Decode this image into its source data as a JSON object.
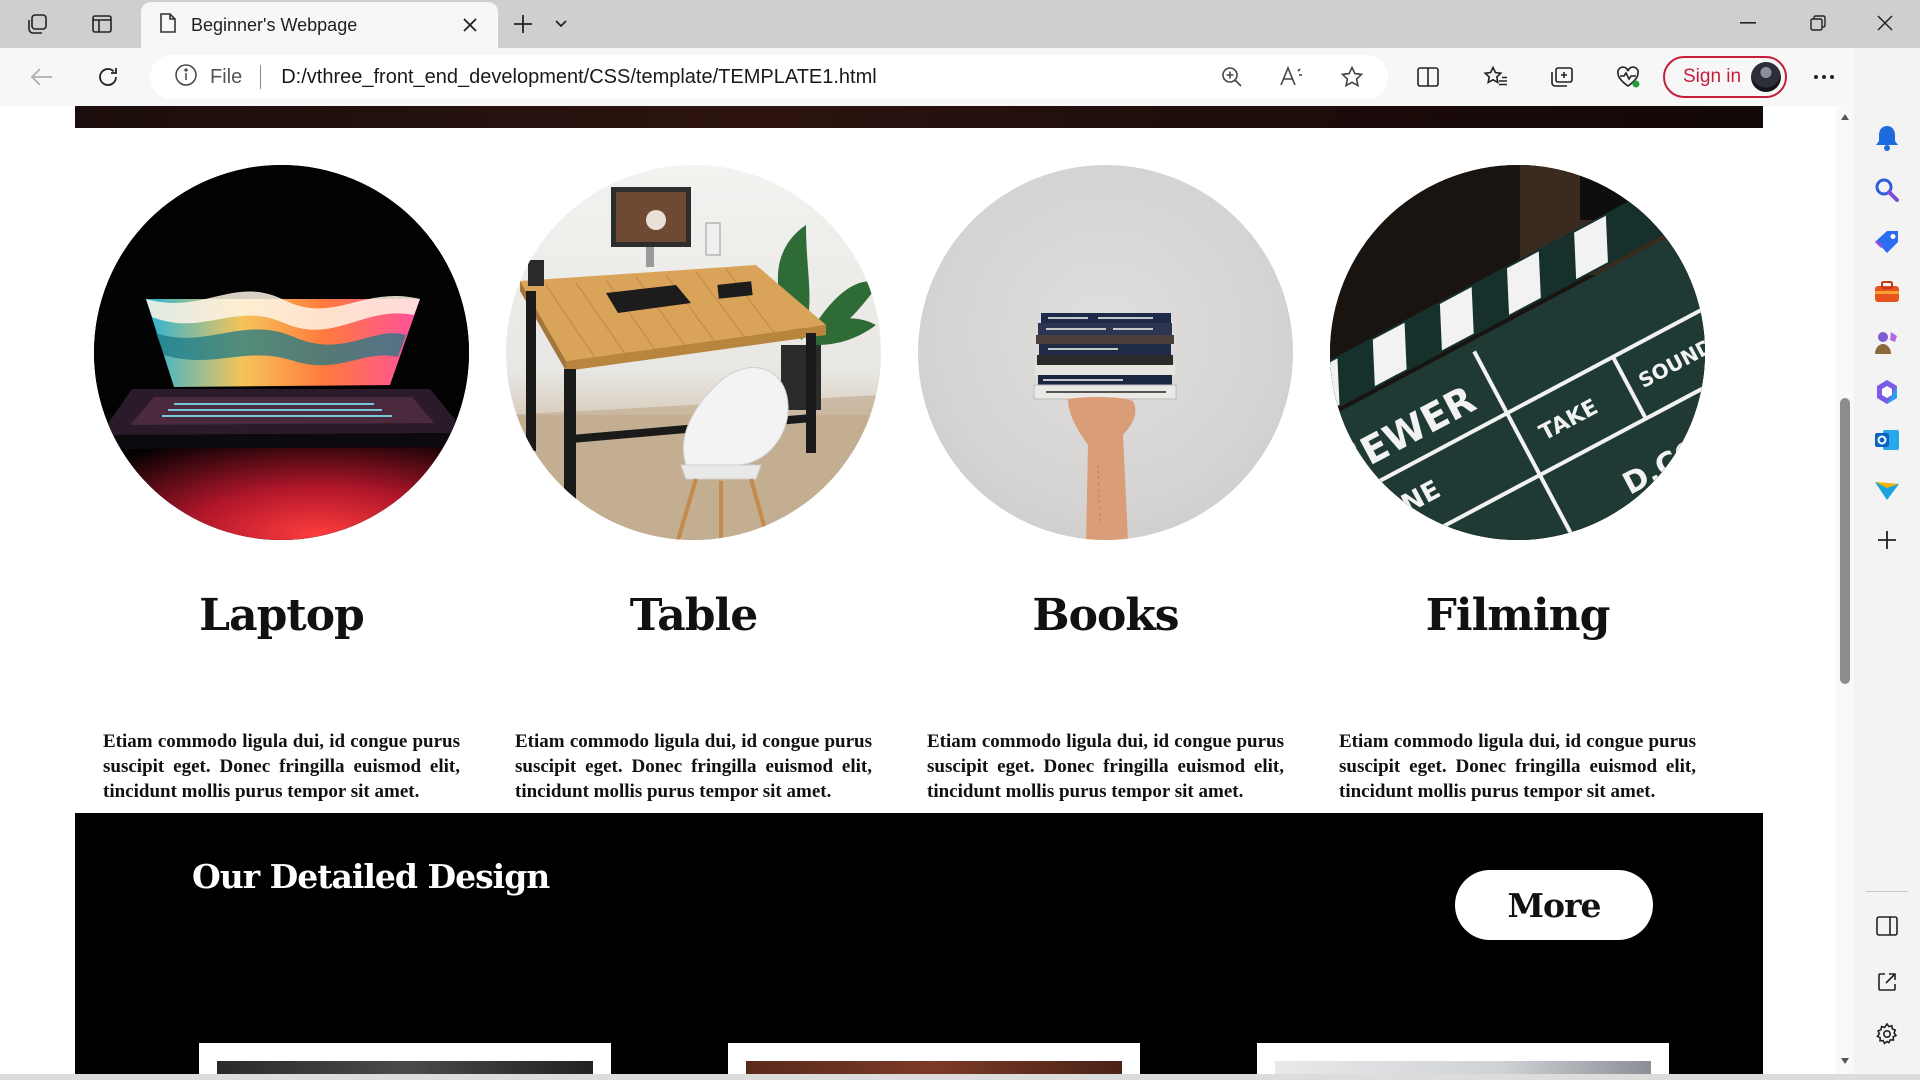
{
  "browser": {
    "tab_title": "Beginner's Webpage",
    "address": {
      "scheme_label": "File",
      "url": "D:/vthree_front_end_development/CSS/template/TEMPLATE1.html"
    },
    "signin_label": "Sign in",
    "icons": {
      "workspaces": "workspaces-icon",
      "tab_actions": "vertical-tabs-icon",
      "page": "page-icon",
      "close_tab": "close-icon",
      "new_tab": "plus-icon",
      "tab_list": "chevron-down-icon",
      "minimize": "minimize-icon",
      "restore": "restore-icon",
      "close_window": "close-icon",
      "back": "back-arrow-icon",
      "refresh": "refresh-icon",
      "site_info": "info-icon",
      "zoom": "zoom-in-icon",
      "read_aloud": "read-aloud-icon",
      "favorite": "star-icon",
      "split_screen": "split-screen-icon",
      "favorites": "favorites-icon",
      "collections": "collections-icon",
      "browser_essentials": "heart-pulse-icon",
      "more": "more-icon",
      "copilot": "copilot-icon"
    },
    "accent_color": "#c41e3a"
  },
  "sidebar": {
    "items": [
      "bell-icon",
      "search-icon",
      "tag-icon",
      "briefcase-icon",
      "games-icon",
      "office-icon",
      "outlook-icon",
      "send-icon",
      "add-icon"
    ],
    "bottom": [
      "sidebar-toggle-icon",
      "open-external-icon",
      "settings-icon"
    ]
  },
  "page": {
    "cards": [
      {
        "title": "Laptop",
        "text": "Etiam commodo ligula dui, id congue purus suscipit eget. Donec fringilla euismod elit, tincidunt mollis purus tempor sit amet."
      },
      {
        "title": "Table",
        "text": "Etiam commodo ligula dui, id congue purus suscipit eget. Donec fringilla euismod elit, tincidunt mollis purus tempor sit amet."
      },
      {
        "title": "Books",
        "text": "Etiam commodo ligula dui, id congue purus suscipit eget. Donec fringilla euismod elit, tincidunt mollis purus tempor sit amet."
      },
      {
        "title": "Filming",
        "text": "Etiam commodo ligula dui, id congue purus suscipit eget. Donec fringilla euismod elit, tincidunt mollis purus tempor sit amet."
      }
    ],
    "detailed": {
      "title": "Our Detailed Design",
      "more_label": "More"
    },
    "clapper_text": [
      "EEWER",
      "CENE",
      "TAKE",
      "SOUND",
      "D.CO."
    ]
  }
}
